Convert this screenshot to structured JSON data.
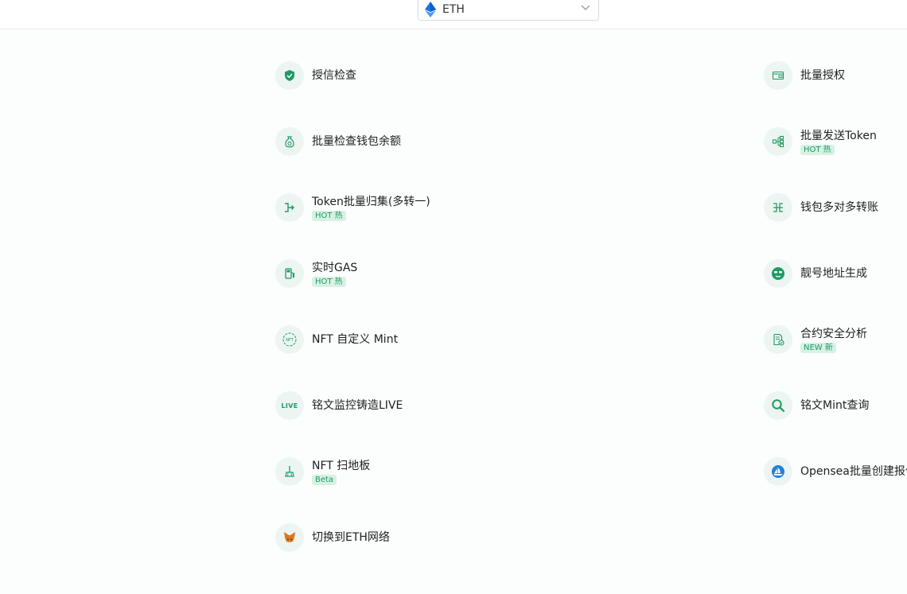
{
  "header": {
    "chain": "ETH"
  },
  "left_tools": [
    {
      "name": "授信检查",
      "badge": "",
      "icon": "shield-check-icon"
    },
    {
      "name": "批量检查钱包余额",
      "badge": "",
      "icon": "money-bag-icon"
    },
    {
      "name": "Token批量归集(多转一)",
      "badge": "HOT 热",
      "icon": "merge-arrow-icon"
    },
    {
      "name": "实时GAS",
      "badge": "HOT 热",
      "icon": "gas-pump-icon"
    },
    {
      "name": "NFT 自定义 Mint",
      "badge": "",
      "icon": "nft-icon",
      "icon_text": "NFT"
    },
    {
      "name": "铭文监控铸造LIVE",
      "badge": "",
      "icon": "live-icon",
      "icon_text": "LIVE"
    },
    {
      "name": "NFT 扫地板",
      "badge": "Beta",
      "icon": "broom-icon"
    },
    {
      "name": "切换到ETH网络",
      "badge": "",
      "icon": "metamask-fox-icon"
    }
  ],
  "right_tools": [
    {
      "name": "批量授权",
      "badge": "",
      "icon": "card-auth-icon"
    },
    {
      "name": "批量发送Token",
      "badge": "HOT 热",
      "icon": "split-send-icon"
    },
    {
      "name": "钱包多对多转账",
      "badge": "",
      "icon": "many-to-many-icon"
    },
    {
      "name": "靓号地址生成",
      "badge": "",
      "icon": "cool-face-icon"
    },
    {
      "name": "合约安全分析",
      "badge": "NEW 新",
      "icon": "contract-check-icon"
    },
    {
      "name": "铭文Mint查询",
      "badge": "",
      "icon": "search-icon"
    },
    {
      "name": "Opensea批量创建报价",
      "badge": "",
      "icon": "opensea-icon"
    }
  ],
  "colors": {
    "accent": "#1e9b63",
    "icon_bg": "#ecf5f1",
    "badge_bg": "#d7f1e4",
    "eth": "#1a73e8",
    "opensea": "#2081e2"
  }
}
